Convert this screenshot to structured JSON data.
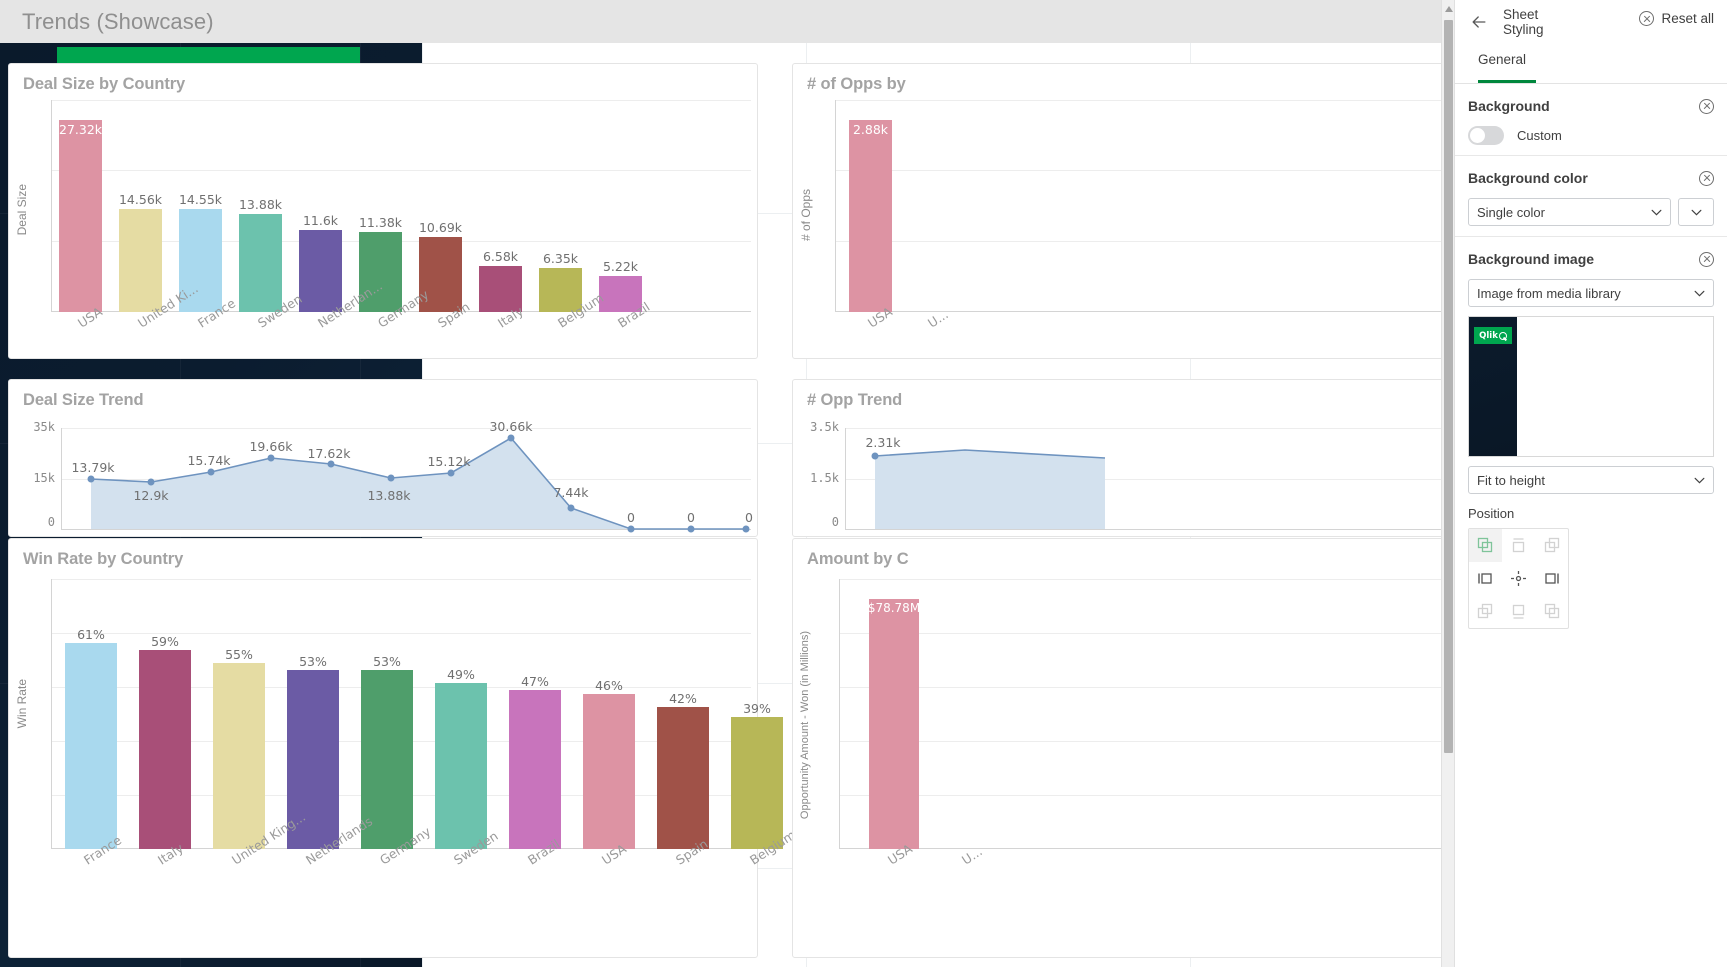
{
  "titlebar": {
    "sheet_title": "Trends (Showcase)"
  },
  "logo": {
    "text": "Qlik",
    "registered": "®"
  },
  "panel": {
    "back_icon": "back-arrow-icon",
    "title": "Sheet Styling",
    "reset_all": "Reset all",
    "tab": "General",
    "accent_color": "#00873d",
    "background": {
      "title": "Background",
      "custom_label": "Custom",
      "custom_on": false
    },
    "background_color": {
      "title": "Background color",
      "mode": "Single color"
    },
    "background_image": {
      "title": "Background image",
      "source": "Image from media library",
      "preview_badge": "Qlik",
      "sizing": "Fit to height",
      "position_label": "Position",
      "position_selected": "top-left",
      "positions": [
        "top-left",
        "top-center",
        "top-right",
        "middle-left",
        "middle-center",
        "middle-right",
        "bottom-left",
        "bottom-center",
        "bottom-right"
      ]
    }
  },
  "charts": [
    {
      "id": "deal-size-by-country",
      "title": "Deal Size by Country",
      "ylabel": "Deal Size"
    },
    {
      "id": "num-opps-by-country",
      "title": "# of Opps by",
      "ylabel": "# of Opps"
    },
    {
      "id": "deal-size-trend",
      "title": "Deal Size Trend"
    },
    {
      "id": "opp-trend",
      "title": "# Opp Trend"
    },
    {
      "id": "win-rate-by-country",
      "title": "Win Rate by Country",
      "ylabel": "Win Rate"
    },
    {
      "id": "amount-by-country",
      "title": "Amount by C",
      "ylabel": "Opportunity Amount - Won (in Millions)"
    }
  ],
  "chart_data": [
    {
      "id": "deal-size-by-country",
      "type": "bar",
      "title": "Deal Size by Country",
      "xlabel": "",
      "ylabel": "Deal Size",
      "categories": [
        "USA",
        "United Ki...",
        "France",
        "Sweden",
        "Netherlan...",
        "Germany",
        "Spain",
        "Italy",
        "Belgium",
        "Brazil"
      ],
      "values": [
        27320,
        14560,
        14550,
        13880,
        11600,
        11380,
        10690,
        6580,
        6350,
        5220
      ],
      "value_labels": [
        "27.32k",
        "14.56k",
        "14.55k",
        "13.88k",
        "11.6k",
        "11.38k",
        "10.69k",
        "6.58k",
        "6.35k",
        "5.22k"
      ],
      "colors": [
        "#dd93a3",
        "#e5dca3",
        "#a9d9ee",
        "#6cc2ad",
        "#6b5ba5",
        "#4f9e6b",
        "#a05248",
        "#a84f78",
        "#b7b757",
        "#c874bc"
      ],
      "ylim": [
        0,
        30000
      ],
      "grid": true
    },
    {
      "id": "num-opps-by-country",
      "type": "bar",
      "title": "# of Opps by",
      "ylabel": "# of Opps",
      "categories": [
        "USA",
        "U..."
      ],
      "values": [
        2880
      ],
      "value_labels": [
        "2.88k"
      ],
      "colors": [
        "#dd93a3"
      ],
      "ylim": [
        0,
        3000
      ],
      "grid": true
    },
    {
      "id": "deal-size-trend",
      "type": "area",
      "title": "Deal Size Trend",
      "xlabel": "",
      "ylabel": "",
      "yticks": [
        "0",
        "15k",
        "35k"
      ],
      "ytick_values": [
        0,
        15000,
        35000
      ],
      "values": [
        13790,
        12900,
        15740,
        19660,
        17620,
        13880,
        15120,
        30660,
        7440,
        0,
        0,
        0
      ],
      "value_labels": [
        "13.79k",
        "12.9k",
        "15.74k",
        "19.66k",
        "17.62k",
        "13.88k",
        "15.12k",
        "30.66k",
        "7.44k",
        "0",
        "0",
        "0"
      ],
      "line_color": "#6e93bf",
      "fill_color": "#d3e1ee",
      "ylim": [
        0,
        38000
      ],
      "grid": true
    },
    {
      "id": "opp-trend",
      "type": "area",
      "title": "# Opp Trend",
      "yticks": [
        "0",
        "1.5k",
        "3.5k"
      ],
      "ytick_values": [
        0,
        1500,
        3500
      ],
      "values": [
        2310
      ],
      "value_labels": [
        "2.31k"
      ],
      "line_color": "#6e93bf",
      "fill_color": "#d3e1ee",
      "ylim": [
        0,
        3800
      ],
      "grid": true
    },
    {
      "id": "win-rate-by-country",
      "type": "bar",
      "title": "Win Rate by Country",
      "xlabel": "",
      "ylabel": "Win Rate",
      "categories": [
        "France",
        "Italy",
        "United King...",
        "Netherlands",
        "Germany",
        "Sweden",
        "Brazil",
        "USA",
        "Spain",
        "Belgium"
      ],
      "values": [
        61,
        59,
        55,
        53,
        53,
        49,
        47,
        46,
        42,
        39
      ],
      "value_labels": [
        "61%",
        "59%",
        "55%",
        "53%",
        "53%",
        "49%",
        "47%",
        "46%",
        "42%",
        "39%"
      ],
      "colors": [
        "#a9d9ee",
        "#a84f78",
        "#e5dca3",
        "#6b5ba5",
        "#4f9e6b",
        "#6cc2ad",
        "#c874bc",
        "#dd93a3",
        "#a05248",
        "#b7b757"
      ],
      "ylim": [
        0,
        80
      ],
      "grid": true
    },
    {
      "id": "amount-by-country",
      "type": "bar",
      "title": "Amount by C",
      "ylabel": "Opportunity Amount - Won (in Millions)",
      "categories": [
        "USA",
        "U..."
      ],
      "values": [
        78780000
      ],
      "value_labels": [
        "$78.78M"
      ],
      "colors": [
        "#dd93a3"
      ],
      "grid": true
    }
  ]
}
